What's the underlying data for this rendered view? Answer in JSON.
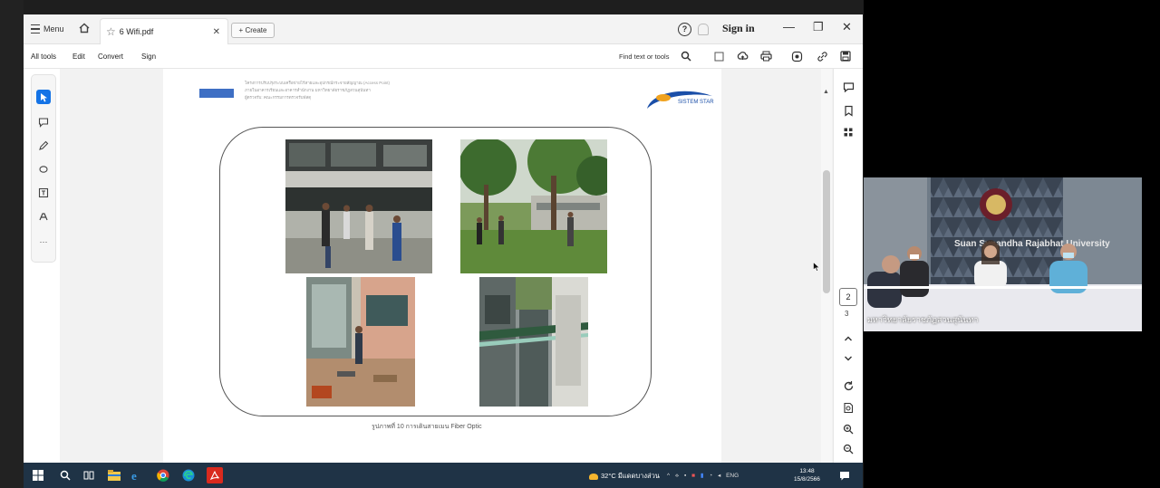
{
  "title_bar": {
    "menu_label": "Menu",
    "tab_title": "6 Wifi.pdf",
    "create_label": "+ Create",
    "help_symbol": "?",
    "sign_in": "Sign in",
    "minimize": "—",
    "restore": "❐",
    "close": "✕"
  },
  "toolbar": {
    "items": [
      "All tools",
      "Edit",
      "Convert",
      "Sign"
    ],
    "find_label": "Find text or tools"
  },
  "document": {
    "header_lines": [
      "โครงการปรับปรุงระบบเครือข่ายไร้สายและอุปกรณ์กระจายสัญญาณ (Access Point)",
      "ภายในอาคารเรียนและอาคารสำนักงาน มหาวิทยาลัยราชภัฏสวนสุนันทา",
      "ผู้ตรวจรับ: คณะกรรมการตรวจรับพัสดุ"
    ],
    "logo_text": "SISTEM STAR",
    "caption": "รูปภาพที่ 10 การเดินสายเมน Fiber Optic"
  },
  "page_nav": {
    "current": "2",
    "next": "3"
  },
  "taskbar": {
    "weather": "32°C มีแดดบางส่วน",
    "lang": "ENG",
    "time": "13:48",
    "date": "15/8/2566"
  },
  "video": {
    "participant_name": "มหาวิทยาลัยราชภัฏสวนสุนันทา",
    "backdrop_text": "Suan Sunandha Rajabhat University"
  },
  "colors": {
    "accent_blue": "#1473e6",
    "taskbar": "#1f3346",
    "acrobat_red": "#d92a1e"
  }
}
